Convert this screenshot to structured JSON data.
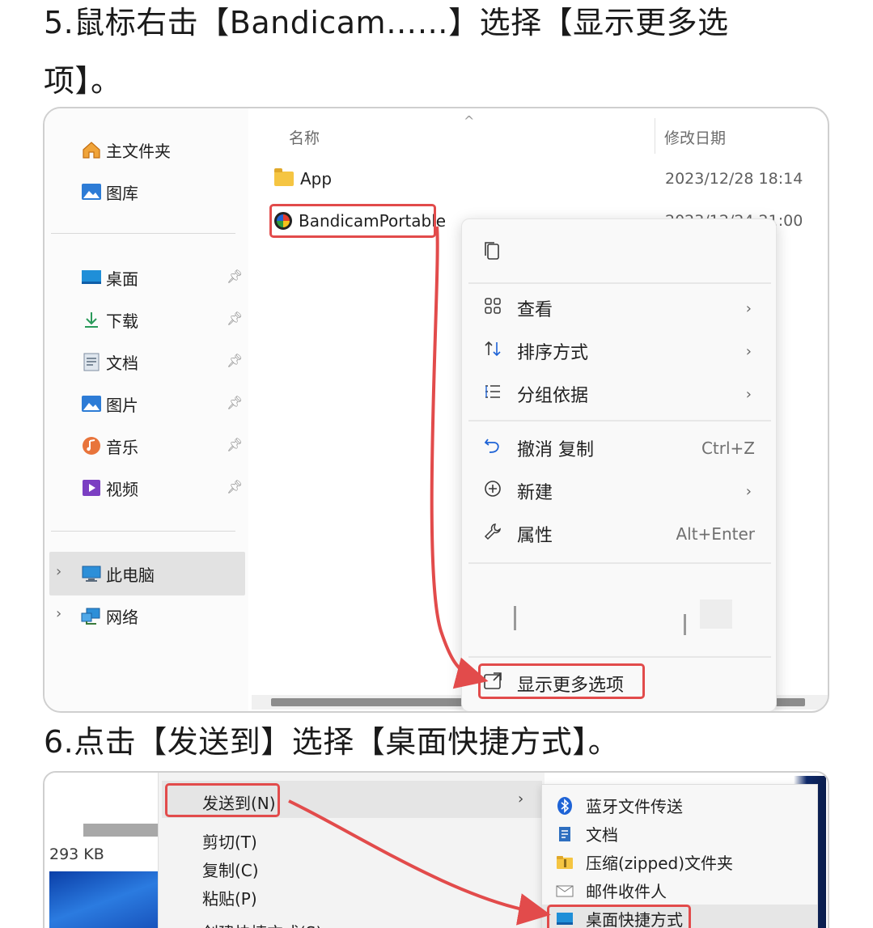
{
  "steps": {
    "step5_line1": "5.鼠标右击【Bandicam……】选择【显示更多选",
    "step5_line2": "项】。",
    "step6": "6.点击【发送到】选择【桌面快捷方式】。"
  },
  "explorer": {
    "nav": {
      "home": "主文件夹",
      "gallery": "图库",
      "pinned": [
        {
          "label": "桌面",
          "icon": "desktop-icon"
        },
        {
          "label": "下载",
          "icon": "download-icon"
        },
        {
          "label": "文档",
          "icon": "document-icon"
        },
        {
          "label": "图片",
          "icon": "pictures-icon"
        },
        {
          "label": "音乐",
          "icon": "music-icon"
        },
        {
          "label": "视频",
          "icon": "video-icon"
        }
      ],
      "this_pc": "此电脑",
      "network": "网络"
    },
    "columns": {
      "name": "名称",
      "modified": "修改日期"
    },
    "files": [
      {
        "name": "App",
        "modified": "2023/12/28 18:14"
      },
      {
        "name": "BandicamPortable",
        "modified": "2023/12/24 21:00"
      }
    ],
    "context_menu": {
      "items": [
        {
          "label": "查看",
          "icon": "grid-view-icon",
          "chevron": "›"
        },
        {
          "label": "排序方式",
          "icon": "sort-icon",
          "chevron": "›"
        },
        {
          "label": "分组依据",
          "icon": "group-icon",
          "chevron": "›"
        },
        {
          "label": "撤消 复制",
          "icon": "undo-icon",
          "shortcut": "Ctrl+Z"
        },
        {
          "label": "新建",
          "icon": "new-icon",
          "chevron": "›"
        },
        {
          "label": "属性",
          "icon": "wrench-icon",
          "shortcut": "Alt+Enter"
        }
      ],
      "show_more": "显示更多选项"
    }
  },
  "sendto": {
    "file_size": "293 KB",
    "menu": [
      "发送到(N)",
      "剪切(T)",
      "复制(C)",
      "粘贴(P)",
      "创建快捷方式(S)"
    ],
    "submenu": [
      {
        "label": "蓝牙文件传送",
        "icon": "bluetooth-icon"
      },
      {
        "label": "文档",
        "icon": "document-icon"
      },
      {
        "label": "压缩(zipped)文件夹",
        "icon": "zip-folder-icon"
      },
      {
        "label": "邮件收件人",
        "icon": "mail-icon"
      },
      {
        "label": "桌面快捷方式",
        "icon": "desktop-icon"
      }
    ]
  },
  "colors": {
    "highlight": "#e24b4b",
    "accent": "#1e63d6"
  }
}
